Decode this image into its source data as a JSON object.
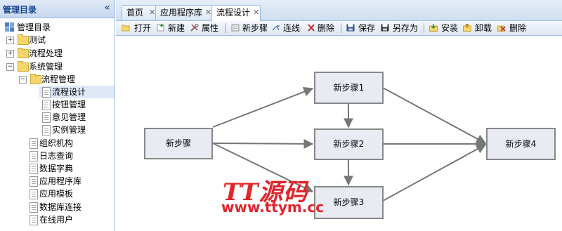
{
  "sidebar": {
    "title": "管理目录",
    "collapse_icon": "double-chevron-left-icon",
    "root_label": "管理目录",
    "items": [
      {
        "label": "测试",
        "type": "folder",
        "expand": "+"
      },
      {
        "label": "流程处理",
        "type": "folder",
        "expand": "+"
      },
      {
        "label": "系统管理",
        "type": "folder",
        "expand": "−"
      },
      {
        "label": "流程管理",
        "type": "folder",
        "expand": "−"
      },
      {
        "label": "流程设计",
        "type": "page",
        "selected": true
      },
      {
        "label": "按钮管理",
        "type": "page"
      },
      {
        "label": "意见管理",
        "type": "page"
      },
      {
        "label": "实例管理",
        "type": "page"
      },
      {
        "label": "组织机构",
        "type": "page"
      },
      {
        "label": "日志查询",
        "type": "page"
      },
      {
        "label": "数据字典",
        "type": "page"
      },
      {
        "label": "应用程序库",
        "type": "page"
      },
      {
        "label": "应用模板",
        "type": "page"
      },
      {
        "label": "数据库连接",
        "type": "page"
      },
      {
        "label": "在线用户",
        "type": "page"
      }
    ]
  },
  "tabs": [
    {
      "label": "首页",
      "closable": true
    },
    {
      "label": "应用程序库",
      "closable": true
    },
    {
      "label": "流程设计",
      "closable": true,
      "active": true
    }
  ],
  "toolbar": [
    {
      "label": "打开",
      "icon": "folder-open-icon"
    },
    {
      "label": "新建",
      "icon": "new-file-icon"
    },
    {
      "label": "属性",
      "icon": "tools-icon"
    },
    {
      "label": "新步骤",
      "icon": "step-icon"
    },
    {
      "label": "连线",
      "icon": "connector-icon"
    },
    {
      "label": "删除",
      "icon": "delete-x-icon"
    },
    {
      "label": "保存",
      "icon": "save-icon"
    },
    {
      "label": "另存为",
      "icon": "save-as-icon"
    },
    {
      "label": "安装",
      "icon": "install-icon"
    },
    {
      "label": "卸载",
      "icon": "uninstall-icon"
    },
    {
      "label": "删除",
      "icon": "delete-x-icon"
    }
  ],
  "flow": {
    "nodes": [
      {
        "id": "start",
        "label": "新步骤"
      },
      {
        "id": "s1",
        "label": "新步骤1"
      },
      {
        "id": "s2",
        "label": "新步骤2"
      },
      {
        "id": "s3",
        "label": "新步骤3"
      },
      {
        "id": "s4",
        "label": "新步骤4"
      }
    ],
    "edges": [
      [
        "start",
        "s1"
      ],
      [
        "start",
        "s2"
      ],
      [
        "start",
        "s3"
      ],
      [
        "s1",
        "s2"
      ],
      [
        "s2",
        "s3"
      ],
      [
        "s1",
        "s4"
      ],
      [
        "s2",
        "s4"
      ],
      [
        "s3",
        "s4"
      ]
    ]
  },
  "watermark": {
    "text": "TT源码",
    "url": "www.ttym.cc"
  },
  "colors": {
    "accent": "#99bbe8",
    "header_text": "#15428b",
    "watermark": "#e0262c"
  }
}
